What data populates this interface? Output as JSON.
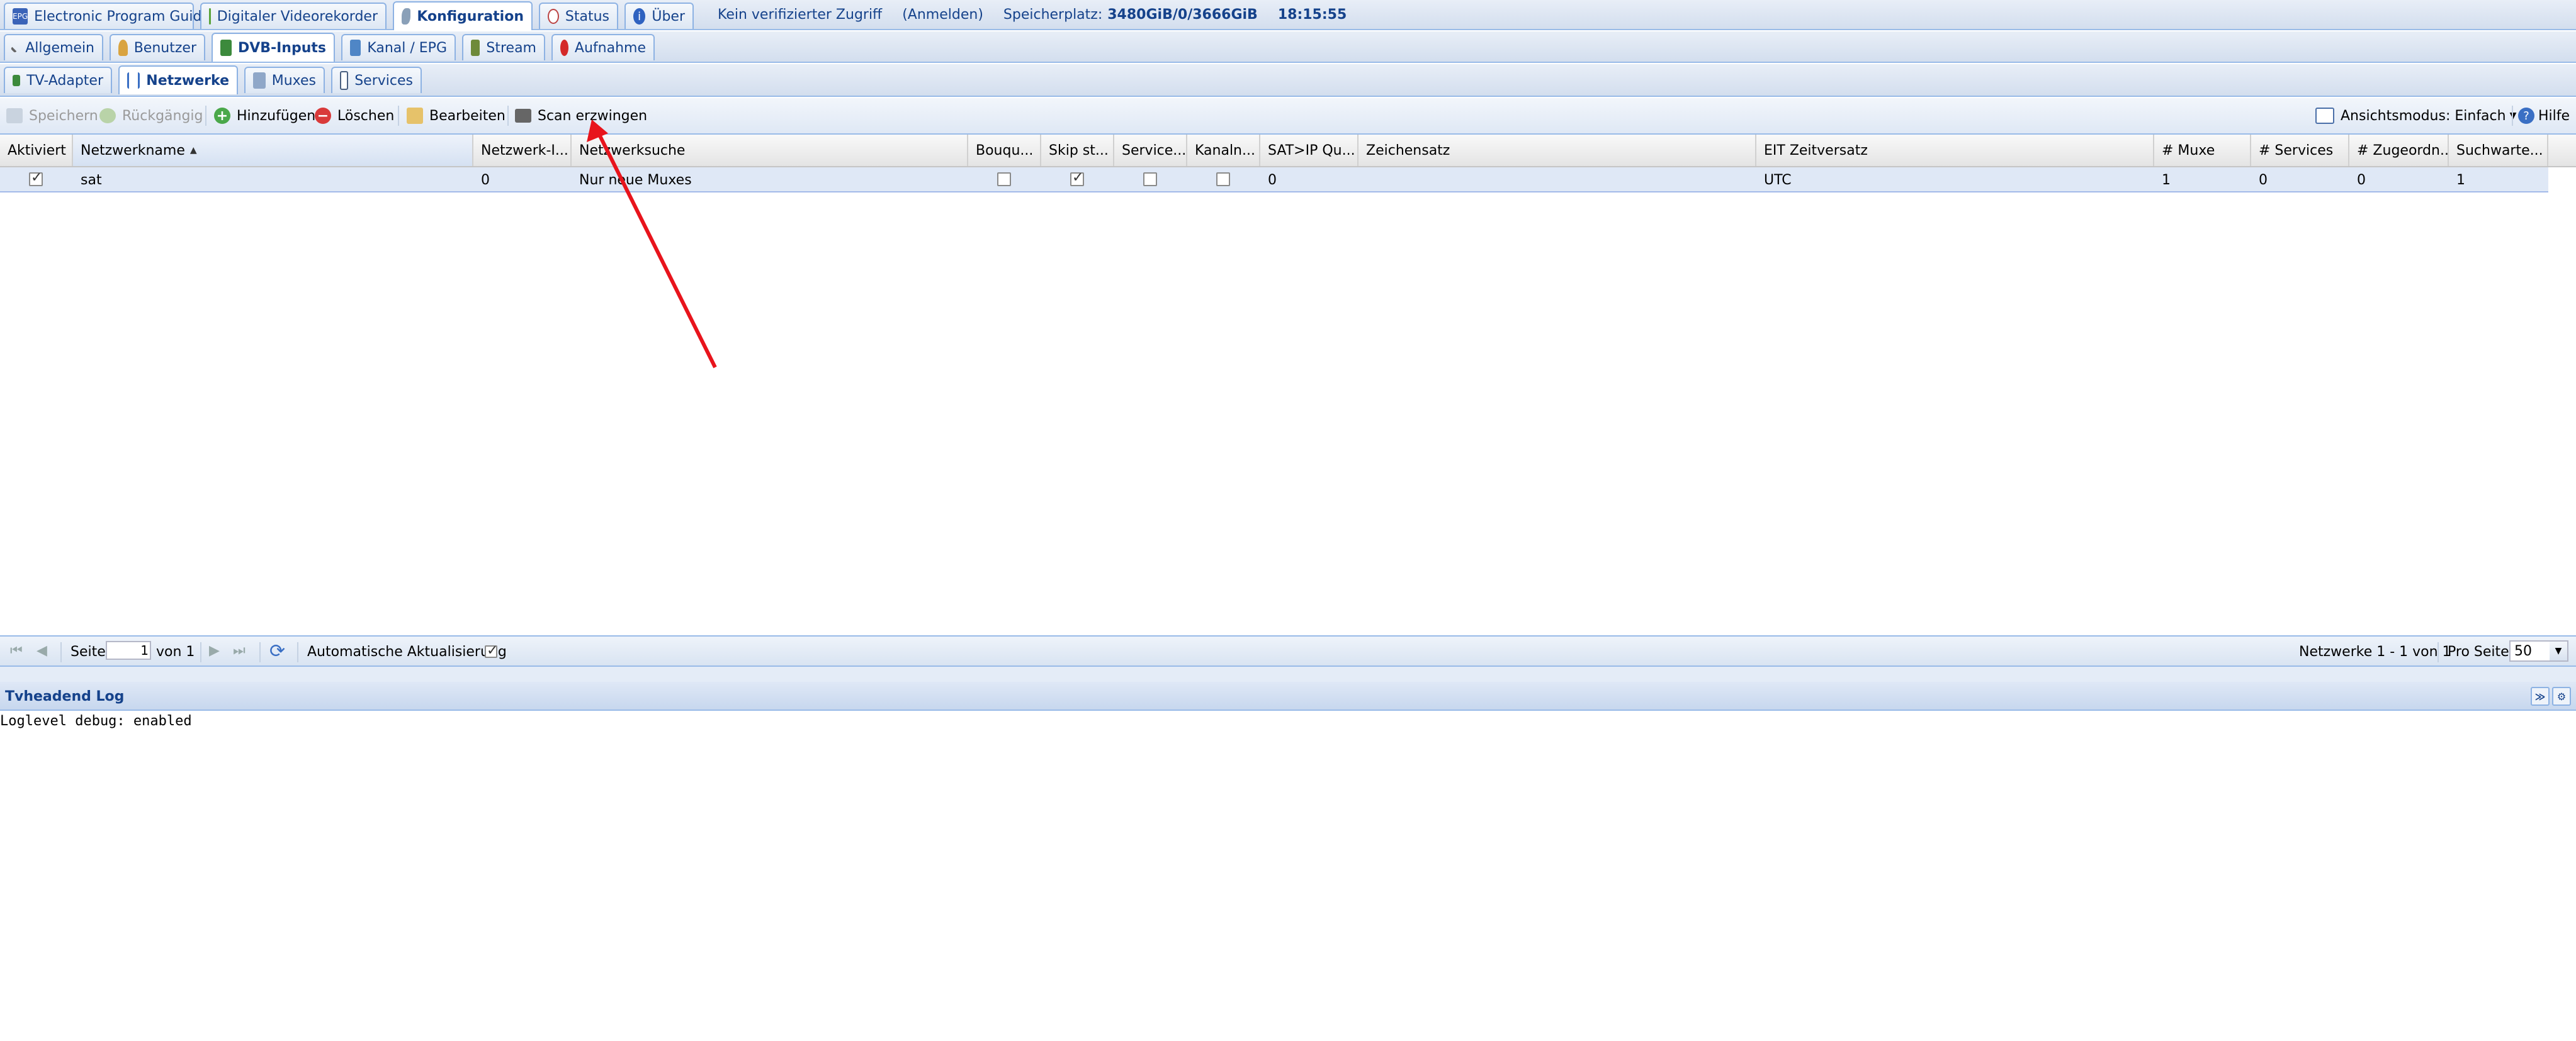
{
  "main_tabs": [
    {
      "label": "Electronic Program Guide",
      "icon": "epg-icon"
    },
    {
      "label": "Digitaler Videorekorder",
      "icon": "download-icon"
    },
    {
      "label": "Konfiguration",
      "icon": "wrench-icon"
    },
    {
      "label": "Status",
      "icon": "eye-icon"
    },
    {
      "label": "Über",
      "icon": "info-icon"
    }
  ],
  "header_status": {
    "access": "Kein verifizierter Zugriff",
    "login": "(Anmelden)",
    "storage_label": "Speicherplatz:",
    "storage_value": "3480GiB/0/3666GiB",
    "time": "18:15:55"
  },
  "config_tabs": [
    {
      "label": "Allgemein",
      "icon": "tools-icon"
    },
    {
      "label": "Benutzer",
      "icon": "users-icon"
    },
    {
      "label": "DVB-Inputs",
      "icon": "card-icon"
    },
    {
      "label": "Kanal / EPG",
      "icon": "tv-icon"
    },
    {
      "label": "Stream",
      "icon": "film-icon"
    },
    {
      "label": "Aufnahme",
      "icon": "record-icon"
    }
  ],
  "dvb_tabs": [
    {
      "label": "TV-Adapter",
      "icon": "adapter-icon"
    },
    {
      "label": "Netzwerke",
      "icon": "antenna-icon"
    },
    {
      "label": "Muxes",
      "icon": "mux-icon"
    },
    {
      "label": "Services",
      "icon": "services-icon"
    }
  ],
  "toolbar": {
    "save": "Speichern",
    "undo": "Rückgängig",
    "add": "Hinzufügen",
    "delete": "Löschen",
    "edit": "Bearbeiten",
    "force_scan": "Scan erzwingen",
    "view_mode": "Ansichtsmodus: Einfach",
    "help": "Hilfe"
  },
  "columns": [
    "Aktiviert",
    "Netzwerkname",
    "Netzwerk-I...",
    "Netzwerksuche",
    "Bouqu...",
    "Skip st...",
    "Service...",
    "Kanaln...",
    "SAT>IP Qu...",
    "Zeichensatz",
    "EIT Zeitversatz",
    "# Muxe",
    "# Services",
    "# Zugeordn...",
    "Suchwarte..."
  ],
  "rows": [
    {
      "aktiviert": true,
      "name": "sat",
      "network_id": "0",
      "netzwerksuche": "Nur neue Muxes",
      "bouquet": false,
      "skip_startup": true,
      "service_sid": false,
      "kanalnummer": false,
      "satip": "0",
      "zeichensatz": "",
      "eit": "UTC",
      "muxe": "1",
      "services": "0",
      "zugeordnet": "0",
      "suchwarte": "1"
    }
  ],
  "pager": {
    "page_label": "Seite",
    "page_value": "1",
    "of_label": "von 1",
    "auto_refresh": "Automatische Aktualisierung",
    "auto_refresh_checked": true,
    "summary": "Netzwerke 1 - 1 von 1",
    "per_page_label": "Pro Seite",
    "per_page": "50"
  },
  "log": {
    "title": "Tvheadend Log",
    "line": "Loglevel debug: enabled"
  },
  "annotation": {
    "color": "#e8141c"
  }
}
